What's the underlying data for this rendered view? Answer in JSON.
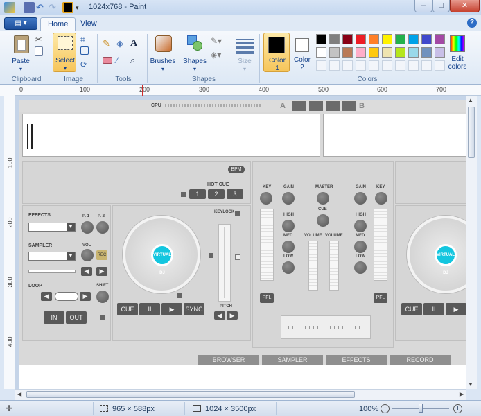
{
  "title_bar": {
    "title": "1024x768 - Paint",
    "minimize": "–",
    "maximize": "□",
    "close": "✕"
  },
  "ribbon_tabs": {
    "file_menu": "▤ ▾",
    "tabs": [
      "Home",
      "View"
    ],
    "active_tab": "Home",
    "help": "?"
  },
  "groups": {
    "clipboard": {
      "label": "Clipboard",
      "paste": "Paste"
    },
    "image": {
      "label": "Image",
      "select": "Select"
    },
    "tools": {
      "label": "Tools"
    },
    "shapes": {
      "label": "Shapes",
      "brushes": "Brushes",
      "shapes_btn": "Shapes",
      "size": "Size"
    },
    "colors": {
      "label": "Colors",
      "color1": "Color\n1",
      "color2": "Color\n2",
      "edit_colors": "Edit\ncolors",
      "palette_row1": [
        "#000000",
        "#7f7f7f",
        "#880015",
        "#ed1c24",
        "#ff7f27",
        "#fff200",
        "#22b14c",
        "#00a2e8",
        "#3f48cc",
        "#a349a4"
      ],
      "palette_row2": [
        "#ffffff",
        "#c3c3c3",
        "#b97a57",
        "#ffaec9",
        "#ffc90e",
        "#efe4b0",
        "#b5e61d",
        "#99d9ea",
        "#7092be",
        "#c8bfe7"
      ]
    }
  },
  "ruler": {
    "h_labels": [
      "0",
      "100",
      "200",
      "300",
      "400",
      "500",
      "600",
      "700"
    ],
    "v_labels": [
      "100",
      "200",
      "300",
      "400"
    ]
  },
  "canvas_image": {
    "cpu": "CPU",
    "deck_a": "A",
    "deck_b": "B",
    "bpm": "BPM",
    "hot_cue": "HOT CUE",
    "hot_cue_buttons": [
      "1",
      "2",
      "3"
    ],
    "effects": "EFFECTS",
    "p1": "P. 1",
    "p2": "P. 2",
    "sampler": "SAMPLER",
    "vol": "VOL",
    "rec": "REC",
    "loop": "LOOP",
    "shift": "SHIFT",
    "in": "IN",
    "out": "OUT",
    "keylock": "KEYLOCK",
    "pitch": "PITCH",
    "transport": [
      "CUE",
      "II",
      "▶",
      "SYNC"
    ],
    "transport_right": [
      "CUE",
      "II",
      "▶"
    ],
    "mixer": {
      "key": "KEY",
      "gain": "GAIN",
      "master": "MASTER",
      "cue": "CUE",
      "high": "HIGH",
      "med": "MED",
      "low": "LOW",
      "volume": "VOLUME",
      "pfl": "PFL"
    },
    "bottom_tabs": [
      "BROWSER",
      "SAMPLER",
      "EFFECTS",
      "RECORD"
    ],
    "platter_label": "VIRTUAL DJ"
  },
  "status_bar": {
    "selection_size": "965 × 588px",
    "image_size": "1024 × 3500px",
    "zoom": "100%"
  }
}
